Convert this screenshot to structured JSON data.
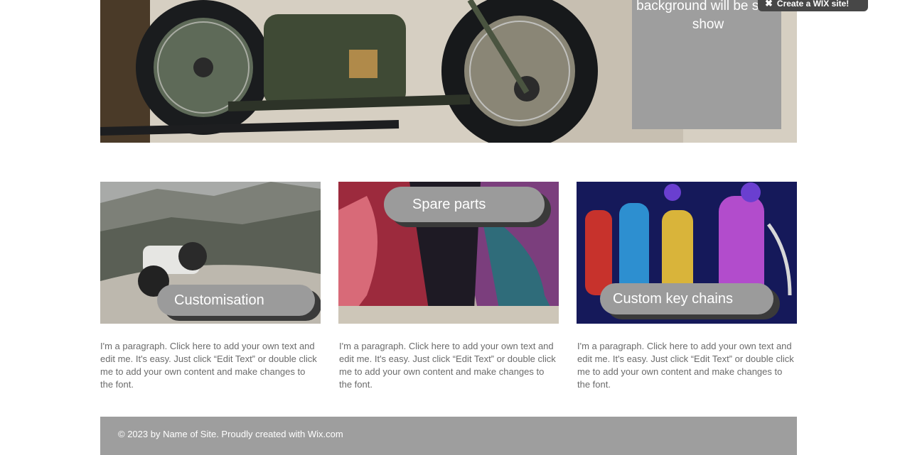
{
  "hero": {
    "overlay_text": "background will be slide show",
    "image": "motorcycle-photo"
  },
  "wix_badge": {
    "icon": "wix-x-icon",
    "label": "Create a WIX site!"
  },
  "tiles": [
    {
      "button_label": "Customisation",
      "image": "motorcycle-on-hill-photo",
      "paragraph": "I'm a paragraph. Click here to add your own text and edit me. It's easy. Just click “Edit Text” or double click me to add your own content and make changes to the font."
    },
    {
      "button_label": "Spare parts",
      "image": "chrome-fenders-photo",
      "paragraph": "I'm a paragraph. Click here to add your own text and edit me. It's easy. Just click “Edit Text” or double click me to add your own content and make changes to the font."
    },
    {
      "button_label": "Custom key chains",
      "image": "nos-keychains-photo",
      "paragraph": "I'm a paragraph. Click here to add your own text and edit me. It's easy. Just click “Edit Text” or double click me to add your own content and make changes to the font."
    }
  ],
  "footer": {
    "text": "© 2023 by Name of Site. Proudly created with Wix.com"
  },
  "colors": {
    "pill": "#9b9b9b",
    "footer": "#9e9e9e",
    "paragraph": "#6b6b6b"
  }
}
